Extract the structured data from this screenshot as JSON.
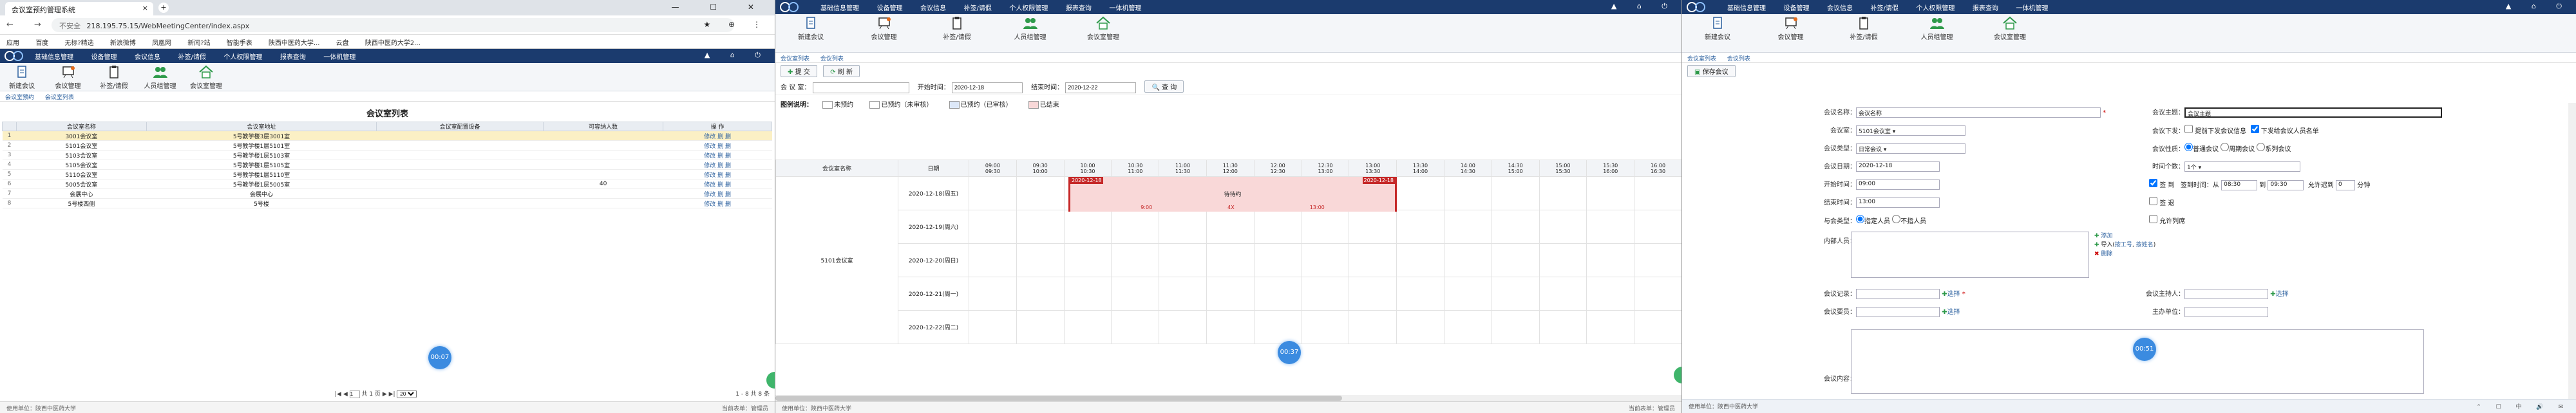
{
  "browser": {
    "tab_title": "会议室预约管理系统",
    "tab_close": "×",
    "new_tab": "+",
    "window_controls": "— ☐ ✕",
    "security_label": "不安全",
    "url": "218.195.75.15/WebMeetingCenter/index.aspx",
    "bookmarks": [
      "应用",
      "百度",
      "无标?精选",
      "新浪微博",
      "凤凰网",
      "新闻?站",
      "智能手表",
      "陕西中医药大学...",
      "云盘 ",
      "陕西中医药大学2..."
    ]
  },
  "app": {
    "menu": [
      "基础信息管理",
      "设备管理",
      "会议信息",
      "补签/请假",
      "个人权限管理",
      "报表查询",
      "一体机管理"
    ],
    "toolbar": [
      "新建会议",
      "会议管理",
      "补签/请假",
      "人员组管理",
      "会议室管理"
    ],
    "footer_left": "使用单位：陕西中医药大学",
    "footer_right": "当前表单：管理员"
  },
  "p1": {
    "crumbs": [
      "会议室预约",
      "会议室列表"
    ],
    "title": "会议室列表",
    "columns": [
      "",
      "会议室名称",
      "会议室地址",
      "会议室配置设备",
      "可容纳人数",
      "操 作"
    ],
    "rows": [
      {
        "n": "1",
        "name": "3001会议室",
        "addr": "5号教学楼3层3001室",
        "equip": "",
        "cap": "",
        "ops": "修改 删 删"
      },
      {
        "n": "2",
        "name": "5101会议室",
        "addr": "5号教学楼1层5101室",
        "equip": "",
        "cap": "",
        "ops": "修改 删 删"
      },
      {
        "n": "3",
        "name": "5103会议室",
        "addr": "5号教学楼1层5103室",
        "equip": "",
        "cap": "",
        "ops": "修改 删 删"
      },
      {
        "n": "4",
        "name": "5105会议室",
        "addr": "5号教学楼1层5105室",
        "equip": "",
        "cap": "",
        "ops": "修改 删 删"
      },
      {
        "n": "5",
        "name": "5110会议室",
        "addr": "5号教学楼1层5110室",
        "equip": "",
        "cap": "",
        "ops": "修改 删 删"
      },
      {
        "n": "6",
        "name": "5005会议室",
        "addr": "5号教学楼1层5005室",
        "equip": "",
        "cap": "40",
        "ops": "修改 删 删"
      },
      {
        "n": "7",
        "name": "会展中心",
        "addr": "会展中心",
        "equip": "",
        "cap": "",
        "ops": "修改 删 删"
      },
      {
        "n": "8",
        "name": "5号楼西侧",
        "addr": "5号楼",
        "equip": "",
        "cap": "",
        "ops": "修改 删 删"
      }
    ],
    "pager_pages": "共 1 页",
    "pager_page": "1",
    "pager_size": "20",
    "pager_info": "1 - 8 共 8 条",
    "bubble": "00:07"
  },
  "p2": {
    "crumbs": [
      "会议室列表",
      "会议列表"
    ],
    "btn_submit": "提 交",
    "btn_refresh": "刷 新",
    "search_room_label": "会 议 室：",
    "search_start_label": "开始时间：",
    "search_start": "2020-12-18",
    "search_end_label": "结束时间：",
    "search_end": "2020-12-22",
    "search_btn": "查 询",
    "legend_title": "图例说明：",
    "legend": [
      {
        "label": "未预约",
        "color": "#ffffff"
      },
      {
        "label": "已预约（未审核）",
        "color": "#ffffff"
      },
      {
        "label": "已预约（已审核）",
        "color": "#dde8f8"
      },
      {
        "label": "已结束",
        "color": "#f9d8d8"
      }
    ],
    "col_room": "会议室名称",
    "col_date": "日期",
    "times": [
      "09:00\n09:30",
      "09:30\n10:00",
      "10:00\n10:30",
      "10:30\n11:00",
      "11:00\n11:30",
      "11:30\n12:00",
      "12:00\n12:30",
      "12:30\n13:00",
      "13:00\n13:30",
      "13:30\n14:00",
      "14:00\n14:30",
      "14:30\n15:00",
      "15:00\n15:30",
      "15:30\n16:00",
      "16:00\n16:30"
    ],
    "room": "5101会议室",
    "dates": [
      "2020-12-18(周五)",
      "2020-12-19(周六)",
      "2020-12-20(周日)",
      "2020-12-21(周一)",
      "2020-12-22(周二)"
    ],
    "booking": {
      "start_tag": "2020-12-18",
      "end_tag": "2020-12-18",
      "status": "待待约",
      "count": "4X",
      "start_time": "9:00",
      "end_time": "13:00"
    },
    "bubble": "00:37"
  },
  "p3": {
    "crumbs": [
      "会议室列表",
      "会议列表"
    ],
    "btn_save": "保存会议",
    "f": {
      "name_label": "会议名称：",
      "name": "会议名称",
      "subject_label": "会议主题：",
      "subject": "会议主题",
      "room_label": "会议室：",
      "room": "5101会议室",
      "notify_label": "会议下发：",
      "notify1": "提前下发会议信息",
      "notify2": "下发给会议人员名单",
      "type_label": "会议类型：",
      "type": "日常会议",
      "nature_label": "会议性质：",
      "nature1": "普通会议",
      "nature2": "周期会议",
      "nature3": "系列会议",
      "date_label": "会议日期：",
      "date": "2020-12-18",
      "slot_label": "时间个数：",
      "slot": "1个",
      "start_label": "开始时间：",
      "start": "09:00",
      "sign_label": "签 到",
      "sign_from_label": "签到时间：从",
      "sign_from": "08:30",
      "sign_to_label": "到",
      "sign_to": "09:30",
      "late_label": "允许迟到",
      "late": "0",
      "late_unit": "分钟",
      "end_label": "结束时间：",
      "end": "13:00",
      "signout_label": "签 退",
      "leave_label": "允许列席",
      "attend_label": "与会类型：",
      "attend1": "指定人员",
      "attend2": "不指人员",
      "members_label": "内部人员：",
      "add": "添加",
      "import": "导入(",
      "import_a": "按工号",
      "import_b": "按姓名",
      "remove": "删除",
      "recorder_label": "会议记录：",
      "choose": "选择",
      "host_label": "会议主持人：",
      "leader_label": "会议要员：",
      "org_label": "主办单位：",
      "content_label": "会议内容："
    },
    "bubble": "00:51"
  },
  "taskbar": {
    "left": "使用单位：陕西中医药大学",
    "tray": "⌃ ☐ 中 🔊 ✉"
  }
}
